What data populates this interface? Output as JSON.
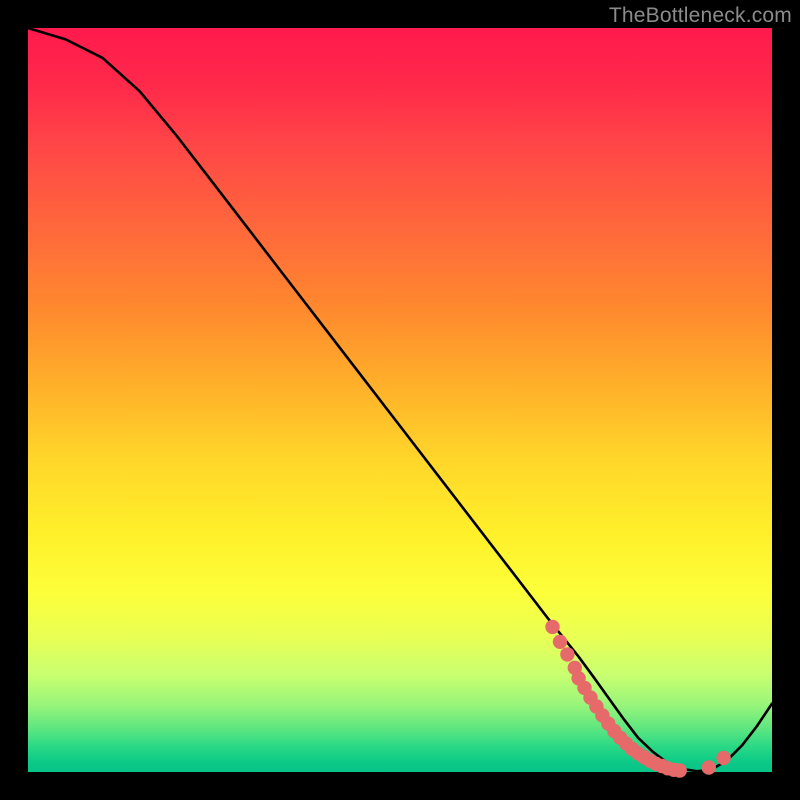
{
  "watermark": "TheBottleneck.com",
  "chart_data": {
    "type": "line",
    "title": "",
    "xlabel": "",
    "ylabel": "",
    "xlim": [
      0,
      100
    ],
    "ylim": [
      0,
      100
    ],
    "grid": false,
    "legend": false,
    "series": [
      {
        "name": "curve",
        "stroke": "#000000",
        "x": [
          0,
          5,
          10,
          15,
          20,
          25,
          30,
          35,
          40,
          45,
          50,
          55,
          60,
          65,
          70,
          72,
          74,
          76,
          78,
          80,
          82,
          84,
          86,
          88,
          90,
          92,
          94,
          96,
          98,
          100
        ],
        "values": [
          100,
          98.5,
          96,
          91.5,
          85.5,
          79,
          72.5,
          66,
          59.5,
          53,
          46.5,
          40,
          33.5,
          27,
          20.5,
          18,
          15.5,
          12.8,
          10,
          7.2,
          4.6,
          2.7,
          1.2,
          0.4,
          0.1,
          0.4,
          1.6,
          3.6,
          6.2,
          9.2
        ]
      }
    ],
    "markers": {
      "name": "highlight-dots",
      "color": "#e66a6a",
      "x": [
        70.5,
        71.5,
        72.5,
        73.5,
        74,
        74.8,
        75.6,
        76.4,
        77.2,
        78,
        78.8,
        79.6,
        80.4,
        81.2,
        82,
        82.8,
        83.6,
        84.4,
        85.2,
        86,
        86.8,
        87.6,
        91.5,
        93.5
      ],
      "y": [
        19.5,
        17.5,
        15.8,
        14.0,
        12.6,
        11.3,
        10.0,
        8.8,
        7.6,
        6.5,
        5.5,
        4.6,
        3.8,
        3.1,
        2.5,
        2.0,
        1.5,
        1.1,
        0.8,
        0.5,
        0.3,
        0.2,
        0.6,
        1.9
      ]
    }
  }
}
